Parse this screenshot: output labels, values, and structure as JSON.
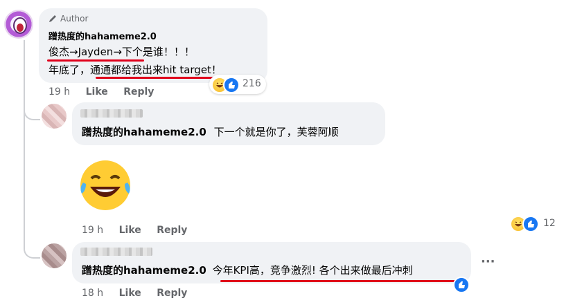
{
  "comments": [
    {
      "author_badge": "Author",
      "author": "蹭热度的hahameme2.0",
      "line1": "俊杰→Jayden→下个是谁！！！",
      "line2": "年底了，通通都给我出来hit target！",
      "time": "19 h",
      "like_label": "Like",
      "reply_label": "Reply",
      "reaction_count": "216"
    },
    {
      "author": "蹭热度的hahameme2.0",
      "text": "下一个就是你了，芙蓉阿顺",
      "time": "19 h",
      "like_label": "Like",
      "reply_label": "Reply",
      "reaction_count": "12"
    },
    {
      "author": "蹭热度的hahameme2.0",
      "text": "今年KPI高，竞争激烈! 各个出来做最后冲刺",
      "time": "18 h",
      "like_label": "Like",
      "reply_label": "Reply",
      "more_label": "···"
    }
  ],
  "colors": {
    "bubble": "#f0f2f5",
    "like_blue": "#1877f2",
    "annotation_red": "#e0001a",
    "meta_gray": "#65676b"
  },
  "icons": [
    "pencil-icon",
    "like-reaction-icon",
    "haha-reaction-icon",
    "laughing-emoji-sticker"
  ]
}
